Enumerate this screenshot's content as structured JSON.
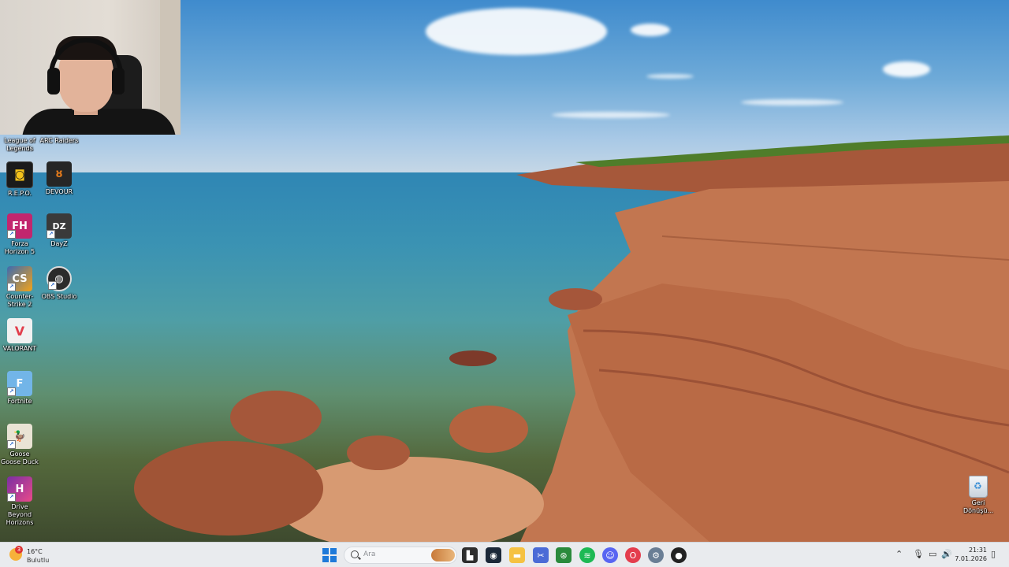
{
  "webcam": {
    "description_hidden": ""
  },
  "desktop_icons_top": [
    {
      "label": "League of Legends",
      "icon": "league-of-legends-icon"
    },
    {
      "label": "ARC Raiders",
      "icon": "arc-raiders-icon"
    }
  ],
  "desktop_icons": [
    {
      "label": "R.E.P.O.",
      "icon": "repo-icon",
      "color": "#1a1a1a"
    },
    {
      "label": "DEVOUR",
      "icon": "devour-icon",
      "color": "#262626"
    },
    {
      "label": "Forza Horizon 5",
      "icon": "forza-horizon-icon",
      "color": "#c2266e"
    },
    {
      "label": "DayZ",
      "icon": "dayz-icon",
      "color": "#3a3a3a"
    },
    {
      "label": "Counter-Strike 2",
      "icon": "counter-strike-icon",
      "color": "#3d6bb0"
    },
    {
      "label": "OBS Studio",
      "icon": "obs-icon",
      "color": "#2b2b2b"
    },
    {
      "label": "VALORANT",
      "icon": "valorant-icon",
      "color": "#f1f1f1"
    },
    {
      "label": "Fortnite",
      "icon": "fortnite-icon",
      "color": "#72b5e8"
    },
    {
      "label": "Goose Goose Duck",
      "icon": "goose-goose-duck-icon",
      "color": "#e9e3d4"
    },
    {
      "label": "Drive Beyond Horizons",
      "icon": "drive-beyond-horizons-icon",
      "color": "#7a2fa3"
    }
  ],
  "recycle_bin": {
    "label": "Geri Dönüşü...",
    "icon": "recycle-bin-icon"
  },
  "taskbar": {
    "weather": {
      "temp": "16°C",
      "condition": "Bulutlu",
      "badge": "3"
    },
    "search_placeholder": "Ara",
    "apps": [
      {
        "name": "file-manager-icon",
        "color": "#2d2d2d",
        "glyph": "▙"
      },
      {
        "name": "steam-icon",
        "color": "#1b2838",
        "glyph": "◉"
      },
      {
        "name": "explorer-folder-icon",
        "color": "#f5c242",
        "glyph": "▬"
      },
      {
        "name": "snipping-tool-icon",
        "color": "#4b6bd6",
        "glyph": "✂"
      },
      {
        "name": "xbox-icon",
        "color": "#2a8a3c",
        "glyph": "⊛"
      },
      {
        "name": "spotify-icon",
        "color": "#1db954",
        "glyph": "≋"
      },
      {
        "name": "discord-icon",
        "color": "#5865f2",
        "glyph": "☺"
      },
      {
        "name": "opera-gx-icon",
        "color": "#e43d4d",
        "glyph": "O"
      },
      {
        "name": "settings-gear-icon",
        "color": "#6a7e95",
        "glyph": "⚙"
      },
      {
        "name": "obs-taskbar-icon",
        "color": "#222222",
        "glyph": "●"
      }
    ],
    "tray": {
      "time": "21:31",
      "date": "7.01.2026"
    }
  }
}
